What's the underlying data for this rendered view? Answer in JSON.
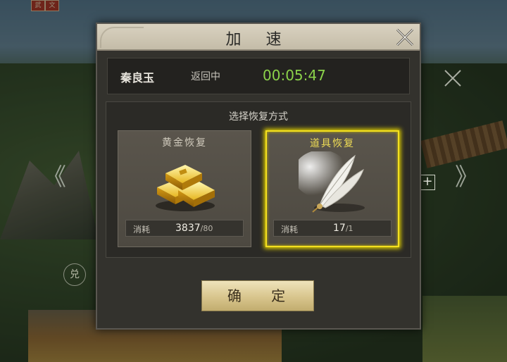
{
  "dialog": {
    "title": "加 速",
    "hero": {
      "name": "秦良玉",
      "status": "返回中",
      "timer": "00:05:47"
    },
    "choose_title": "选择恢复方式",
    "options": [
      {
        "label": "黄金恢复",
        "icon": "gold-ingot-icon",
        "cost_label": "消耗",
        "cost_have": "3837",
        "cost_need": "/80",
        "selected": false
      },
      {
        "label": "道具恢复",
        "icon": "feather-icon",
        "cost_label": "消耗",
        "cost_have": "17",
        "cost_need": "/1",
        "selected": true
      }
    ],
    "confirm_label": "确 定"
  },
  "background": {
    "top_flags": [
      "武",
      "文"
    ],
    "side_left": "《",
    "side_right": "》",
    "plus": "+",
    "circle_glyph": "兑"
  },
  "colors": {
    "timer": "#8bd24a",
    "selected_border": "#f4e020",
    "title_bar": "#d9d2c0",
    "confirm_button": "#d8c58d"
  }
}
